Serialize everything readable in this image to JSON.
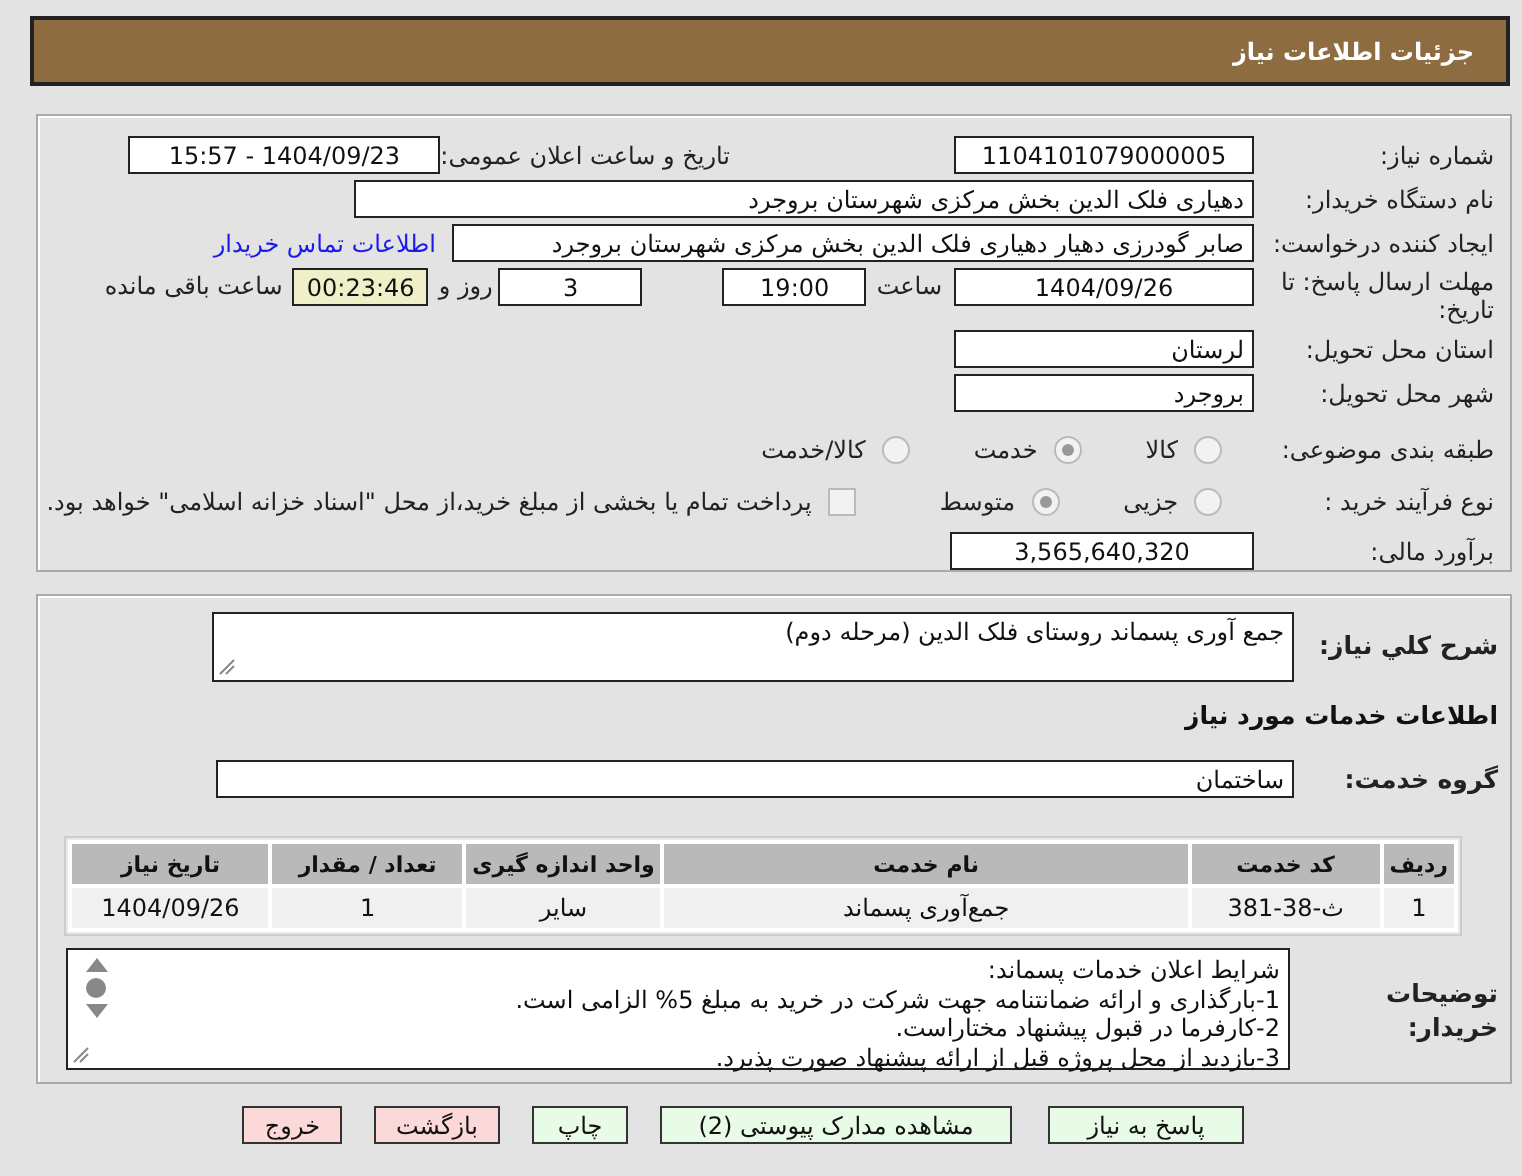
{
  "header": {
    "title": "جزئیات اطلاعات نیاز"
  },
  "need_number": {
    "label": "شماره نیاز:",
    "value": "1104101079000005"
  },
  "announce": {
    "label": "تاریخ و ساعت اعلان عمومی:",
    "value": "1404/09/23 - 15:57"
  },
  "buyer": {
    "label": "نام دستگاه خریدار:",
    "value": "دهیاری فلک الدین بخش مرکزی شهرستان بروجرد"
  },
  "requester": {
    "label": "ایجاد کننده درخواست:",
    "value": "صابر گودرزی دهیار دهیاری فلک الدین بخش مرکزی شهرستان بروجرد",
    "link": "اطلاعات تماس خریدار"
  },
  "deadline": {
    "label": "مهلت ارسال پاسخ: تا تاریخ:",
    "date": "1404/09/26",
    "time_label": "ساعت",
    "time": "19:00",
    "days": "3",
    "days_label": "روز و",
    "remaining": "00:23:46",
    "remaining_label": "ساعت باقی مانده"
  },
  "province": {
    "label": "استان محل تحویل:",
    "value": "لرستان"
  },
  "city": {
    "label": "شهر محل تحویل:",
    "value": "بروجرد"
  },
  "category": {
    "label": "طبقه بندی موضوعی:",
    "options": [
      {
        "label": "کالا",
        "selected": false
      },
      {
        "label": "خدمت",
        "selected": true
      },
      {
        "label": "کالا/خدمت",
        "selected": false
      }
    ]
  },
  "process": {
    "label": "نوع فرآیند خرید :",
    "options": [
      {
        "label": "جزیی",
        "selected": false
      },
      {
        "label": "متوسط",
        "selected": true
      }
    ],
    "payment": {
      "label": "پرداخت تمام یا بخشی از مبلغ خرید،از محل \"اسناد خزانه اسلامی\" خواهد بود.",
      "checked": false
    }
  },
  "budget": {
    "label": "برآورد مالی:",
    "value": "3,565,640,320"
  },
  "summary": {
    "label": "شرح کلي نیاز:",
    "value": "جمع آوری پسماند روستای فلک الدین (مرحله دوم)"
  },
  "services_title": "اطلاعات خدمات مورد نیاز",
  "service_group": {
    "label": "گروه خدمت:",
    "value": "ساختمان"
  },
  "table": {
    "columns": [
      "ردیف",
      "کد خدمت",
      "نام خدمت",
      "واحد اندازه گیری",
      "تعداد / مقدار",
      "تاریخ نیاز"
    ],
    "rows": [
      [
        "1",
        "ث-38-381",
        "جمع‌آوری پسماند",
        "سایر",
        "1",
        "1404/09/26"
      ]
    ]
  },
  "notes": {
    "label": "توضیحات خریدار:",
    "lines": [
      "شرایط اعلان خدمات پسماند:",
      "1-بارگذاری و ارائه ضمانتنامه جهت شرکت در خرید به مبلغ 5% الزامی است.",
      "2-کارفرما در قبول پیشنهاد مختاراست.",
      "3-بازدید از محل پروژه قبل از ارائه پیشنهاد صورت پذیرد."
    ]
  },
  "buttons": [
    {
      "label": "پاسخ به نیاز",
      "kind": "action"
    },
    {
      "label": "مشاهده مدارک پیوستی (2)",
      "kind": "action"
    },
    {
      "label": "چاپ",
      "kind": "action"
    },
    {
      "label": "بازگشت",
      "kind": "exit"
    },
    {
      "label": "خروج",
      "kind": "exit"
    }
  ]
}
